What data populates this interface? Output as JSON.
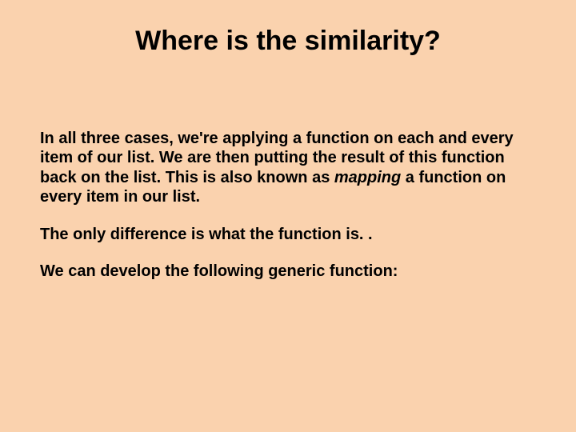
{
  "title": "Where is the similarity?",
  "para1_a": "In all three cases, we're applying a function on each and every item of our list.  We are then putting the result of this function back on the list.  This is also known as ",
  "para1_em": "mapping",
  "para1_b": " a function on every item in our list.",
  "para2": "The only difference is what the function is. .",
  "para3": "We can develop the following generic function:"
}
